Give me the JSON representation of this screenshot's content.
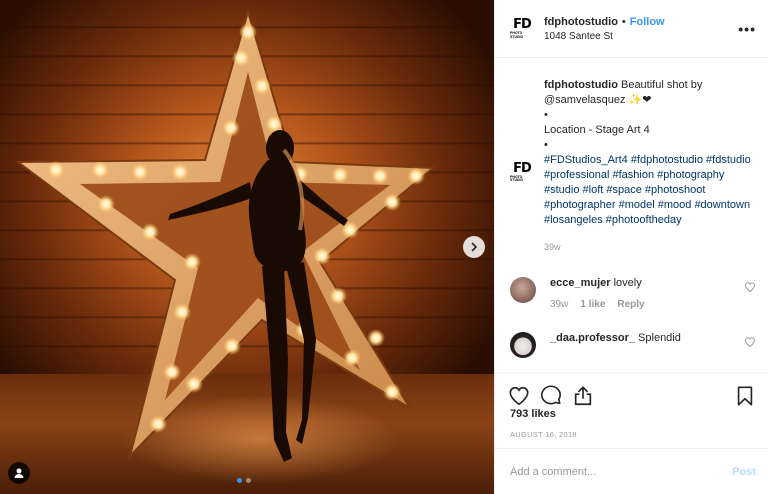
{
  "header": {
    "logo_text": "FD",
    "logo_sub": "PHOTO STUDIO",
    "username": "fdphotostudio",
    "separator": "•",
    "follow_label": "Follow",
    "location": "1048 Santee St",
    "more_icon": "more-horizontal-icon"
  },
  "caption": {
    "username": "fdphotostudio",
    "text_1": "Beautiful shot by",
    "mention": "@samvelasquez",
    "emoji_text": "✨❤",
    "bullet_1": "•",
    "location_line": "Location - Stage Art 4",
    "bullet_2": "•",
    "hashtags": "#FDStudios_Art4 #fdphotostudio #fdstudio #professional #fashion #photography #studio #loft #space #photoshoot #photographer #model #mood #downtown #losangeles #photooftheday",
    "time": "39w"
  },
  "comments": [
    {
      "username": "ecce_mujer",
      "text": "lovely",
      "time": "39w",
      "likes": "1 like",
      "reply": "Reply"
    },
    {
      "username": "_daa.professor_",
      "text": "Splendid"
    }
  ],
  "actions": {
    "like_icon": "heart-icon",
    "comment_icon": "comment-icon",
    "share_icon": "share-icon",
    "save_icon": "bookmark-icon"
  },
  "likes": "793 likes",
  "date": "AUGUST 16, 2018",
  "add_comment": {
    "placeholder": "Add a comment...",
    "post_label": "Post"
  },
  "carousel": {
    "next_icon": "chevron-right-icon",
    "tag_icon": "user-tag-icon",
    "slide_index": 1,
    "slide_count": 2
  },
  "colors": {
    "accent": "#3897f0",
    "hashtag": "#003569",
    "muted": "#999999",
    "post_disabled": "#b2dffc"
  }
}
